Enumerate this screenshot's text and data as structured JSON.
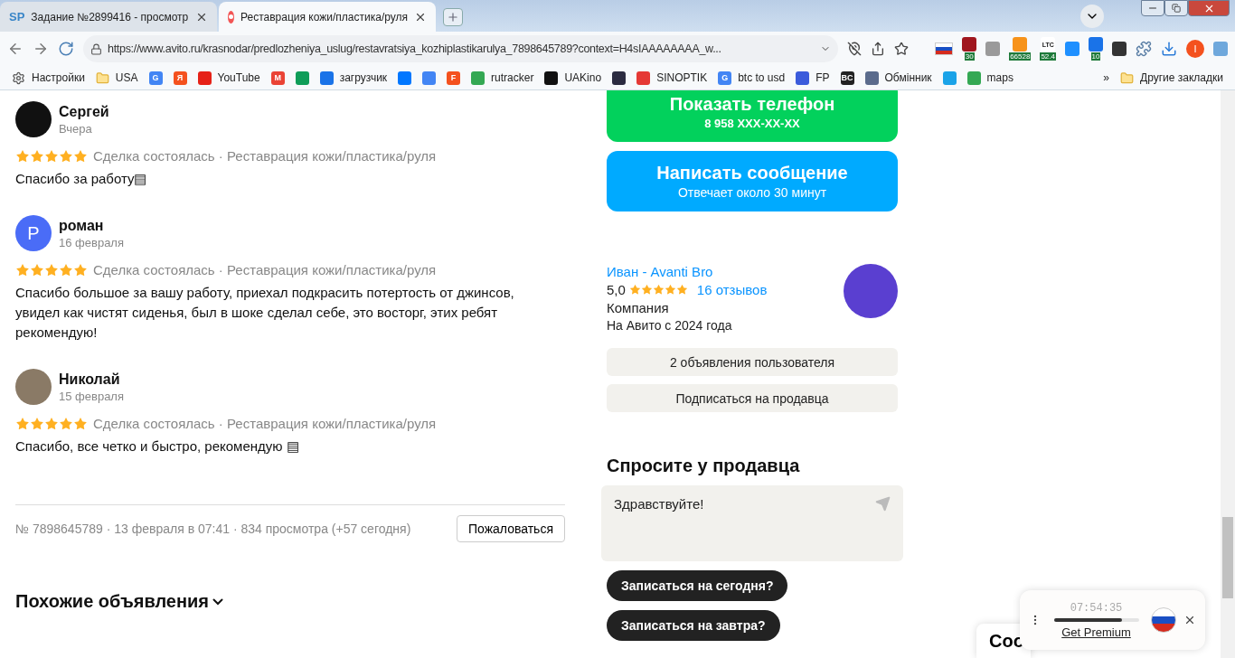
{
  "tabs": [
    {
      "title": "Задание №2899416 - просмотр",
      "selected": false,
      "kind": "letters",
      "glyph": "SP"
    },
    {
      "title": "Реставрация кожи/пластика/руля",
      "selected": true,
      "kind": "dot"
    }
  ],
  "address": {
    "url": "https://www.avito.ru/krasnodar/predlozheniya_uslug/restavratsiya_kozhiplastikarulya_7898645789?context=H4sIAAAAAAAA_w..."
  },
  "extensions": [
    {
      "kind": "flag"
    },
    {
      "kind": "tile",
      "color": "#a0161e",
      "badge": "30"
    },
    {
      "kind": "tile",
      "color": "#9a9a9a"
    },
    {
      "kind": "tile",
      "color": "#f7931a",
      "badge": "66528"
    },
    {
      "kind": "tile",
      "color": "#ffffff",
      "top": "LTC",
      "badge": "52.4"
    },
    {
      "kind": "tile",
      "color": "#1e90ff"
    },
    {
      "kind": "tile",
      "color": "#1a73e8",
      "badge": "10"
    },
    {
      "kind": "tile",
      "color": "#333333"
    },
    {
      "kind": "puzzle"
    },
    {
      "kind": "download"
    },
    {
      "kind": "avatar",
      "color": "#f4511e",
      "glyph": "I"
    },
    {
      "kind": "tile",
      "color": "#6fa8dc"
    }
  ],
  "bookmarks": [
    {
      "kind": "gear",
      "label": "Настройки"
    },
    {
      "kind": "folder",
      "label": "USA"
    },
    {
      "kind": "tile",
      "color": "#4285f4",
      "glyph": "G"
    },
    {
      "kind": "tile",
      "color": "#f4511e",
      "glyph": "Я"
    },
    {
      "kind": "tile",
      "color": "#e62117",
      "label": "YouTube"
    },
    {
      "kind": "tile",
      "color": "#ea4335",
      "glyph": "M"
    },
    {
      "kind": "tile",
      "color": "#0f9d58"
    },
    {
      "kind": "tile",
      "color": "#1a73e8",
      "label": "загрузчик"
    },
    {
      "kind": "tile",
      "color": "#0077ff"
    },
    {
      "kind": "tile",
      "color": "#4285f4"
    },
    {
      "kind": "tile",
      "color": "#f4511e",
      "glyph": "F"
    },
    {
      "kind": "tile",
      "color": "#34a853",
      "label": "rutracker"
    },
    {
      "kind": "tile",
      "color": "#111111",
      "label": "UAKino"
    },
    {
      "kind": "tile",
      "color": "#2b2b40"
    },
    {
      "kind": "tile",
      "color": "#e53935",
      "label": "SINOPTIK"
    },
    {
      "kind": "tile",
      "color": "#4285f4",
      "glyph": "G",
      "label": "btc to usd"
    },
    {
      "kind": "tile",
      "color": "#3b5bdb",
      "label": "FP"
    },
    {
      "kind": "tile",
      "color": "#222222",
      "glyph": "BC"
    },
    {
      "kind": "tile",
      "color": "#5b6b8c",
      "label": "Обмінник"
    },
    {
      "kind": "tile",
      "color": "#1aa3e8"
    },
    {
      "kind": "tile",
      "color": "#34a853",
      "label": "maps"
    }
  ],
  "bookmarks_more": "»",
  "other_bookmarks": "Другие закладки",
  "reviews": [
    {
      "name": "Сергей",
      "date": "Вчера",
      "kind": "logo",
      "stars": 5,
      "deal": "Сделка состоялась · Реставрация кожи/пластика/руля",
      "text": "Спасибо за работу▤"
    },
    {
      "name": "роман",
      "date": "16 февраля",
      "kind": "letter",
      "initial": "Р",
      "stars": 5,
      "deal": "Сделка состоялась · Реставрация кожи/пластика/руля",
      "text": "Спасибо большое за вашу работу, приехал подкрасить потертость от джинсов, увидел как чистят сиденья, был в шоке сделал себе, это восторг, этих ребят рекомендую!"
    },
    {
      "name": "Николай",
      "date": "15 февраля",
      "kind": "photo",
      "stars": 5,
      "deal": "Сделка состоялась · Реставрация кожи/пластика/руля",
      "text": "Спасибо, все четко и быстро, рекомендую ▤"
    }
  ],
  "listing_meta": "№ 7898645789 · 13 февраля в 07:41 · 834 просмотра (+57 сегодня)",
  "report_button": "Пожаловаться",
  "similar_title": "Похожие объявления",
  "phone_button": {
    "title": "Показать телефон",
    "subtitle": "8 958 XXX-XX-XX"
  },
  "message_button": {
    "title": "Написать сообщение",
    "subtitle": "Отвечает около 30 минут"
  },
  "seller": {
    "name": "Иван - Avanti Bro",
    "rating": "5,0",
    "stars": 5,
    "reviews": "16 отзывов",
    "type": "Компания",
    "since": "На Авито с 2024 года"
  },
  "seller_buttons": [
    "2 объявления пользователя",
    "Подписаться на продавца"
  ],
  "ask": {
    "title": "Спросите у продавца",
    "message": "Здравствуйте!",
    "chips": [
      "Записаться на сегодня?",
      "Записаться на завтра?"
    ]
  },
  "cookie_card": "Соо",
  "vpn": {
    "time": "07:54:35",
    "level": 0.8,
    "link": "Get Premium"
  }
}
